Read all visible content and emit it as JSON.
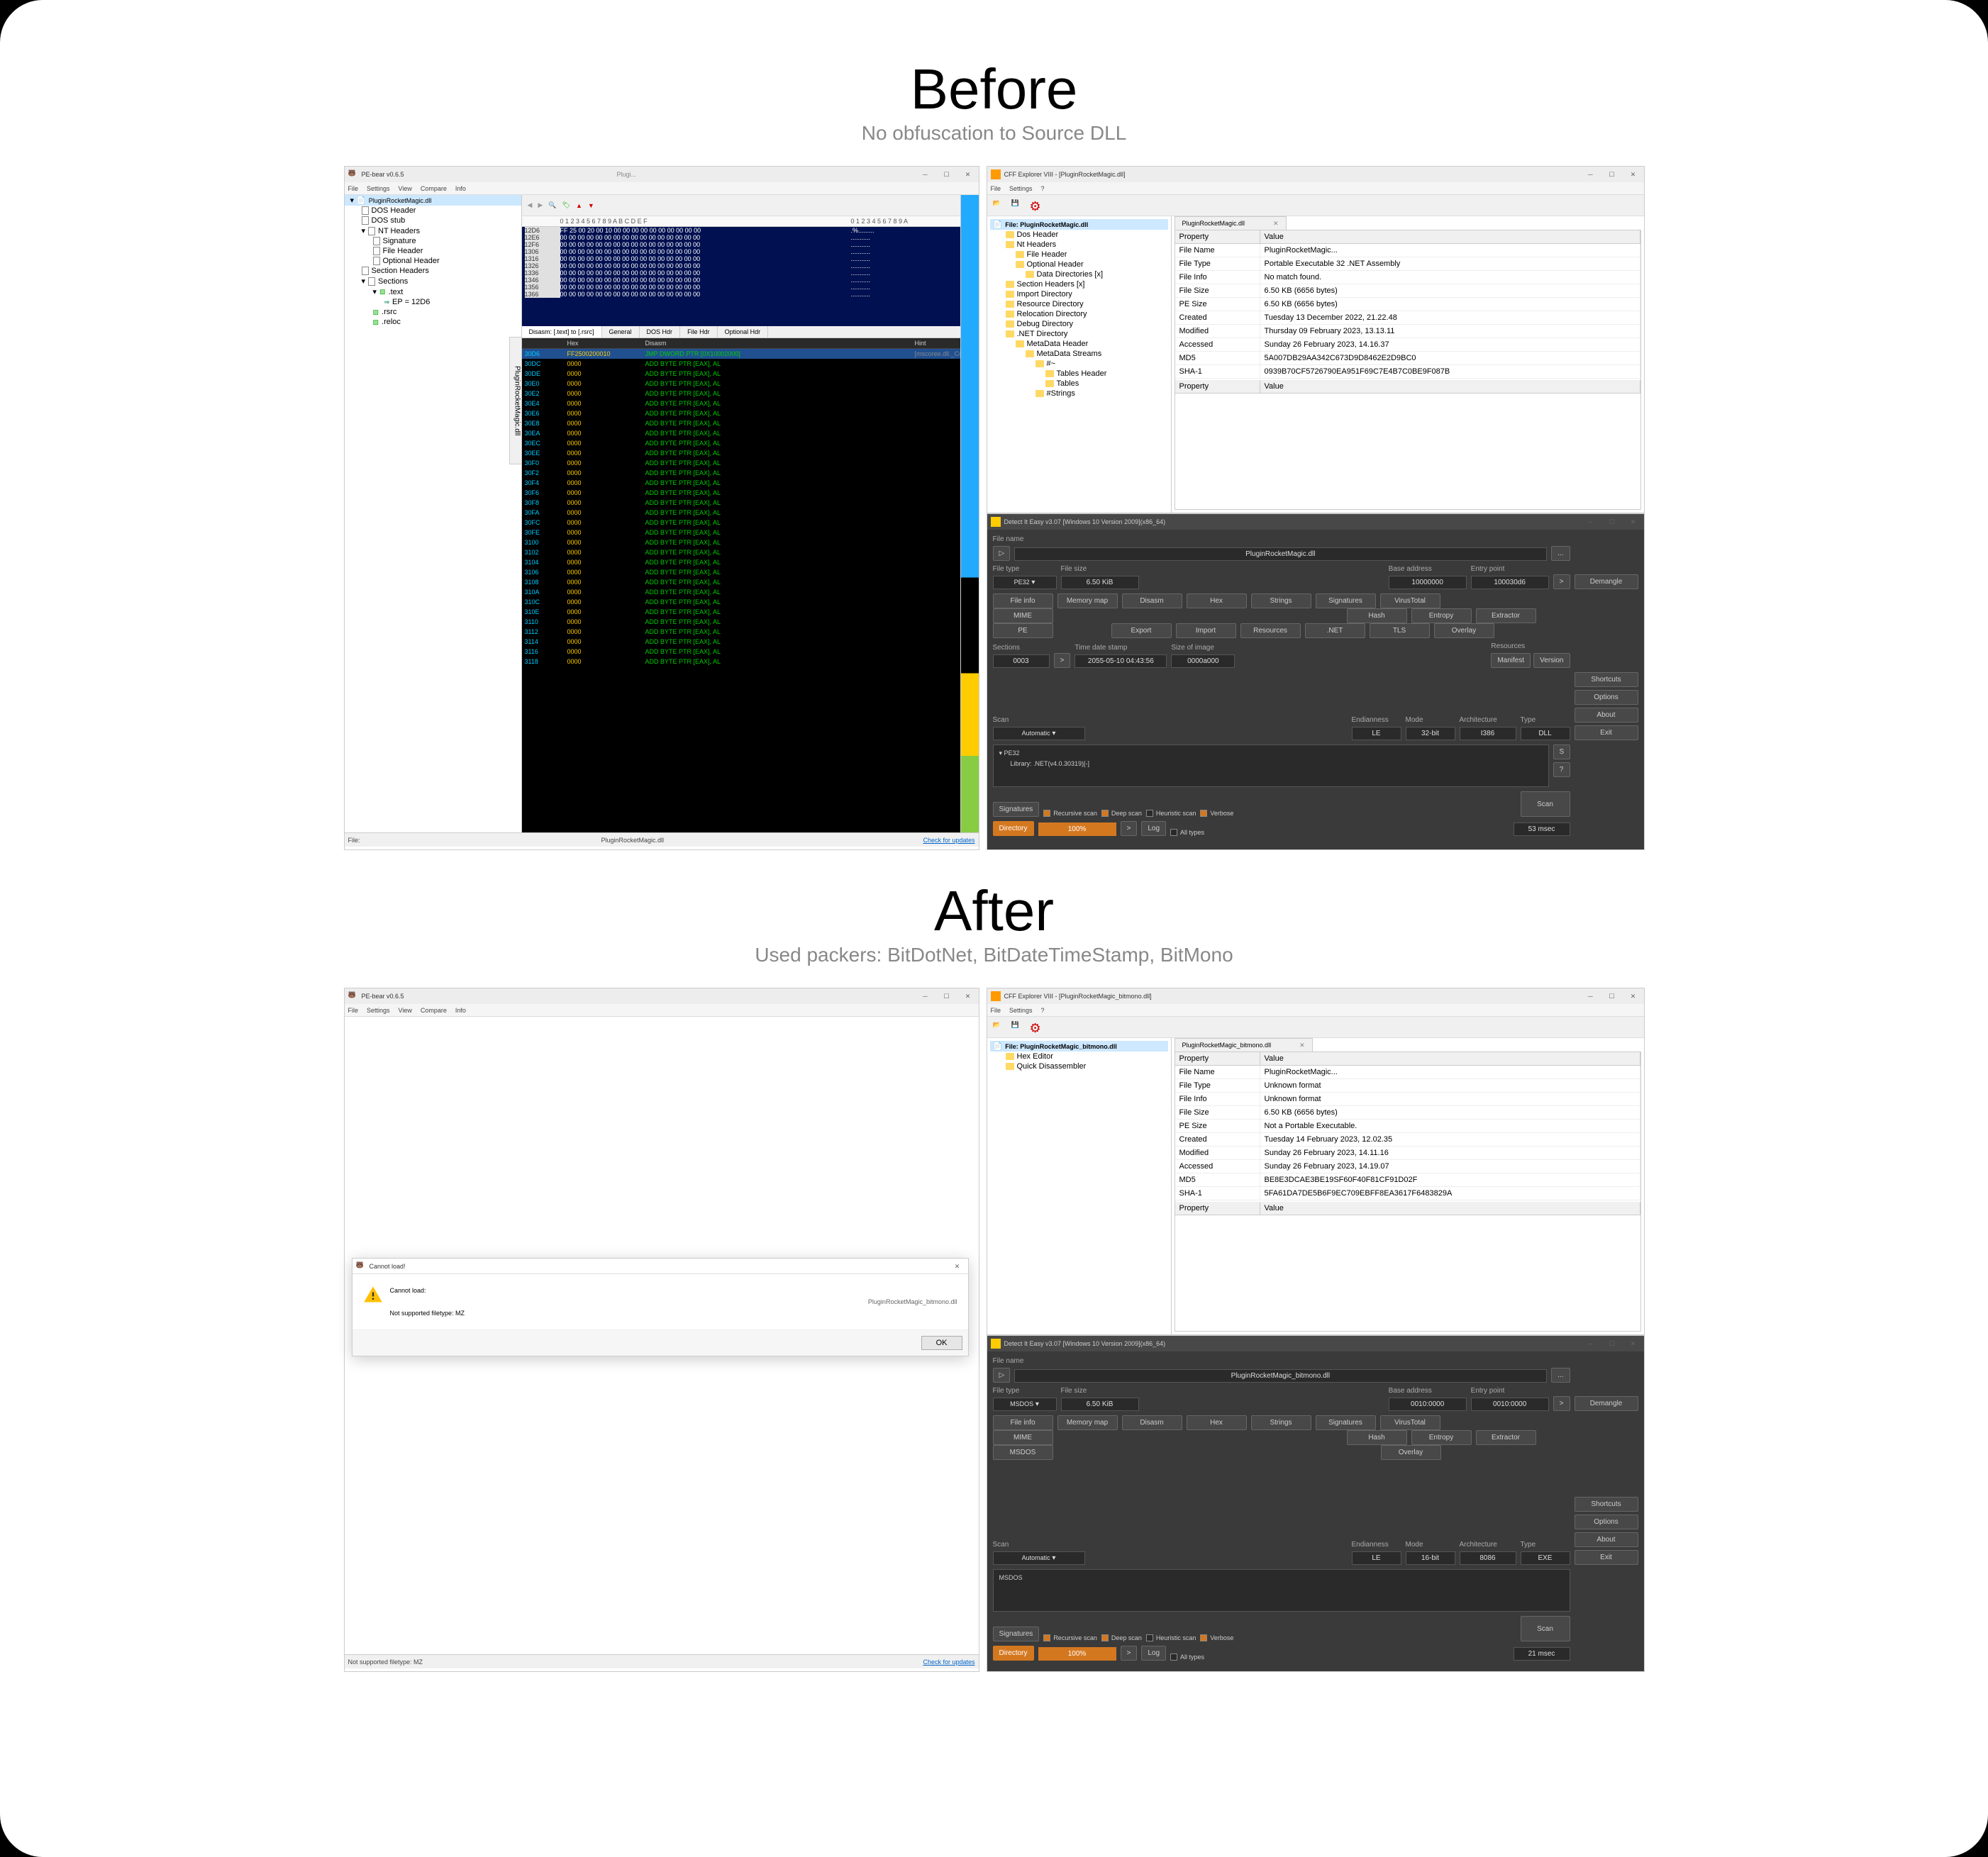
{
  "before": {
    "title": "Before",
    "subtitle": "No obfuscation to Source DLL"
  },
  "after": {
    "title": "After",
    "subtitle": "Used packers: BitDotNet, BitDateTimeStamp, BitMono"
  },
  "pbear_before": {
    "title": "PE-bear v0.6.5",
    "title_file": "Plugi...",
    "menu": [
      "File",
      "Settings",
      "View",
      "Compare",
      "Info"
    ],
    "tree_root": "PluginRocketMagic.dll",
    "tree": [
      {
        "label": "DOS Header",
        "lvl": 1
      },
      {
        "label": "DOS stub",
        "lvl": 1
      },
      {
        "label": "NT Headers",
        "lvl": 1,
        "exp": true
      },
      {
        "label": "Signature",
        "lvl": 2
      },
      {
        "label": "File Header",
        "lvl": 2
      },
      {
        "label": "Optional Header",
        "lvl": 2
      },
      {
        "label": "Section Headers",
        "lvl": 1
      },
      {
        "label": "Sections",
        "lvl": 1,
        "exp": true
      },
      {
        "label": ".text",
        "lvl": 2,
        "exp": true,
        "green": true
      },
      {
        "label": "EP = 12D6",
        "lvl": 3,
        "arrow": true
      },
      {
        "label": ".rsrc",
        "lvl": 2,
        "green": true
      },
      {
        "label": ".reloc",
        "lvl": 2,
        "green": true
      }
    ],
    "hex_header_ofs": "",
    "hex_header_hex": "0 1 2 3 4 5 6 7 8 9 A B C D E F",
    "hex_header_asc": "0 1 2 3 4 5 6 7 8 9 A",
    "hex_rows": [
      {
        "ofs": "12D6",
        "hx": "FF 25 00 20 00 10 00 00 00 00 00 00 00 00 00 00",
        "asc": ".%........."
      },
      {
        "ofs": "12E6",
        "hx": "00 00 00 00 00 00 00 00 00 00 00 00 00 00 00 00",
        "asc": "..........."
      },
      {
        "ofs": "12F6",
        "hx": "00 00 00 00 00 00 00 00 00 00 00 00 00 00 00 00",
        "asc": "..........."
      },
      {
        "ofs": "1306",
        "hx": "00 00 00 00 00 00 00 00 00 00 00 00 00 00 00 00",
        "asc": "..........."
      },
      {
        "ofs": "1316",
        "hx": "00 00 00 00 00 00 00 00 00 00 00 00 00 00 00 00",
        "asc": "..........."
      },
      {
        "ofs": "1326",
        "hx": "00 00 00 00 00 00 00 00 00 00 00 00 00 00 00 00",
        "asc": "..........."
      },
      {
        "ofs": "1336",
        "hx": "00 00 00 00 00 00 00 00 00 00 00 00 00 00 00 00",
        "asc": "..........."
      },
      {
        "ofs": "1346",
        "hx": "00 00 00 00 00 00 00 00 00 00 00 00 00 00 00 00",
        "asc": "..........."
      },
      {
        "ofs": "1356",
        "hx": "00 00 00 00 00 00 00 00 00 00 00 00 00 00 00 00",
        "asc": "..........."
      },
      {
        "ofs": "1366",
        "hx": "00 00 00 00 00 00 00 00 00 00 00 00 00 00 00 00",
        "asc": "..........."
      }
    ],
    "tabs": [
      "Disasm: [.text] to [.rsrc]",
      "General",
      "DOS Hdr",
      "File Hdr",
      "Optional Hdr"
    ],
    "disasm_head": {
      "c1": "",
      "c2": "Hex",
      "c3": "Disasm",
      "c4": "Hint"
    },
    "disasm_first": {
      "ofs": "30D6",
      "hex": "FF2500200010",
      "dis": "JMP DWORD PTR [0X10002000]",
      "hint": "[mscoree.dll._CorDll..."
    },
    "disasm_offsets": [
      "30DC",
      "30DE",
      "30E0",
      "30E2",
      "30E4",
      "30E6",
      "30E8",
      "30EA",
      "30EC",
      "30EE",
      "30F0",
      "30F2",
      "30F4",
      "30F6",
      "30F8",
      "30FA",
      "30FC",
      "30FE",
      "3100",
      "3102",
      "3104",
      "3106",
      "3108",
      "310A",
      "310C",
      "310E",
      "3110",
      "3112",
      "3114",
      "3116",
      "3118"
    ],
    "disasm_repeat_hex": "0000",
    "disasm_repeat_dis": "ADD BYTE PTR [EAX], AL",
    "status_left": "File:",
    "status_file": "PluginRocketMagic.dll",
    "status_link": "Check for updates",
    "vtab": "PluginRocketMagic.dll"
  },
  "cff_before": {
    "title": "CFF Explorer VIII - [PluginRocketMagic.dll]",
    "menu": [
      "File",
      "Settings",
      "?"
    ],
    "file_tab": "PluginRocketMagic.dll",
    "tree_root": "File: PluginRocketMagic.dll",
    "tree": [
      {
        "label": "Dos Header",
        "lvl": 1
      },
      {
        "label": "Nt Headers",
        "lvl": 1,
        "exp": true
      },
      {
        "label": "File Header",
        "lvl": 2
      },
      {
        "label": "Optional Header",
        "lvl": 2,
        "exp": true
      },
      {
        "label": "Data Directories [x]",
        "lvl": 3
      },
      {
        "label": "Section Headers [x]",
        "lvl": 1
      },
      {
        "label": "Import Directory",
        "lvl": 1
      },
      {
        "label": "Resource Directory",
        "lvl": 1
      },
      {
        "label": "Relocation Directory",
        "lvl": 1
      },
      {
        "label": "Debug Directory",
        "lvl": 1
      },
      {
        "label": ".NET Directory",
        "lvl": 1,
        "exp": true
      },
      {
        "label": "MetaData Header",
        "lvl": 2,
        "exp": true
      },
      {
        "label": "MetaData Streams",
        "lvl": 3,
        "exp": true
      },
      {
        "label": "#~",
        "lvl": 4,
        "exp": true
      },
      {
        "label": "Tables Header",
        "lvl": 5
      },
      {
        "label": "Tables",
        "lvl": 5
      },
      {
        "label": "#Strings",
        "lvl": 4
      }
    ],
    "table_header": [
      "Property",
      "Value"
    ],
    "rows": [
      [
        "File Name",
        "PluginRocketMagic..."
      ],
      [
        "File Type",
        "Portable Executable 32 .NET Assembly"
      ],
      [
        "File Info",
        "No match found."
      ],
      [
        "File Size",
        "6.50 KB (6656 bytes)"
      ],
      [
        "PE Size",
        "6.50 KB (6656 bytes)"
      ],
      [
        "Created",
        "Tuesday 13 December 2022, 21.22.48"
      ],
      [
        "Modified",
        "Thursday 09 February 2023, 13.13.11"
      ],
      [
        "Accessed",
        "Sunday 26 February 2023, 14.16.37"
      ],
      [
        "MD5",
        "5A007DB29AA342C673D9D8462E2D9BC0"
      ],
      [
        "SHA-1",
        "0939B70CF5726790EA951F69C7E4B7C0BE9F087B"
      ]
    ],
    "table_header2": [
      "Property",
      "Value"
    ]
  },
  "die_before": {
    "title": "Detect It Easy v3.07 [Windows 10 Version 2009](x86_64)",
    "file_name_label": "File name",
    "file_name": "PluginRocketMagic.dll",
    "file_type_label": "File type",
    "file_type": "PE32",
    "file_size_label": "File size",
    "file_size": "6.50 KiB",
    "base_addr_label": "Base address",
    "base_addr": "10000000",
    "entry_label": "Entry point",
    "entry": "100030d6",
    "demangle": "Demangle",
    "btns_row1": [
      "File info",
      "Memory map",
      "Disasm",
      "Hex",
      "Strings",
      "Signatures",
      "VirusTotal"
    ],
    "btns_row2": [
      "MIME",
      "",
      "",
      "",
      "Hash",
      "Entropy",
      "Extractor"
    ],
    "btns_row3": [
      "PE",
      "",
      "Export",
      "Import",
      "Resources",
      ".NET",
      "TLS",
      "Overlay"
    ],
    "sections_label": "Sections",
    "sections": "0003",
    "timedate_label": "Time date stamp",
    "timedate": "2055-05-10 04:43:56",
    "size_img_label": "Size of image",
    "size_img": "0000a000",
    "resources_label": "Resources",
    "manifest": "Manifest",
    "version": "Version",
    "scan_label": "Scan",
    "auto": "Automatic",
    "endian_label": "Endianness",
    "endian": "LE",
    "mode_label": "Mode",
    "mode": "32-bit",
    "arch_label": "Architecture",
    "arch": "I386",
    "type_label": "Type",
    "type": "DLL",
    "result_pe": "PE32",
    "result_lib": "Library: .NET(v4.0.30319)[-]",
    "s_btn": "S",
    "q_btn": "?",
    "signatures": "Signatures",
    "chk_recursive": "Recursive scan",
    "chk_deep": "Deep scan",
    "chk_heuristic": "Heuristic scan",
    "chk_verbose": "Verbose",
    "directory": "Directory",
    "progress": "100%",
    "log": "Log",
    "all_types": "All types",
    "elapsed": "53 msec",
    "scan": "Scan",
    "right_btns": [
      "Shortcuts",
      "Options",
      "About",
      "Exit"
    ],
    "arrow": ">",
    "ellipsis": "..."
  },
  "pbear_after": {
    "title": "PE-bear v0.6.5",
    "menu": [
      "File",
      "Settings",
      "View",
      "Compare",
      "Info"
    ],
    "msgbox_title": "Cannot load!",
    "msg_line1": "Cannot load:",
    "msg_file": "PluginRocketMagic_bitmono.dll",
    "msg_line2": "Not supported filetype: MZ",
    "ok": "OK",
    "status": "Not supported filetype: MZ",
    "status_link": "Check for updates"
  },
  "cff_after": {
    "title": "CFF Explorer VIII - [PluginRocketMagic_bitmono.dll]",
    "menu": [
      "File",
      "Settings",
      "?"
    ],
    "file_tab": "PluginRocketMagic_bitmono.dll",
    "tree_root": "File: PluginRocketMagic_bitmono.dll",
    "tree": [
      {
        "label": "Hex Editor",
        "lvl": 1
      },
      {
        "label": "Quick Disassembler",
        "lvl": 1
      }
    ],
    "table_header": [
      "Property",
      "Value"
    ],
    "rows": [
      [
        "File Name",
        "PluginRocketMagic..."
      ],
      [
        "File Type",
        "Unknown format"
      ],
      [
        "File Info",
        "Unknown format"
      ],
      [
        "File Size",
        "6.50 KB (6656 bytes)"
      ],
      [
        "PE Size",
        "Not a Portable Executable."
      ],
      [
        "Created",
        "Tuesday 14 February 2023, 12.02.35"
      ],
      [
        "Modified",
        "Sunday 26 February 2023, 14.11.16"
      ],
      [
        "Accessed",
        "Sunday 26 February 2023, 14.19.07"
      ],
      [
        "MD5",
        "BE8E3DCAE3BE19SF60F40F81CF91D02F"
      ],
      [
        "SHA-1",
        "5FA61DA7DE5B6F9EC709EBFF8EA3617F6483829A"
      ]
    ],
    "table_header2": [
      "Property",
      "Value"
    ]
  },
  "die_after": {
    "title": "Detect It Easy v3.07 [Windows 10 Version 2009](x86_64)",
    "file_name_label": "File name",
    "file_name": "PluginRocketMagic_bitmono.dll",
    "file_type_label": "File type",
    "file_type": "MSDOS",
    "file_size_label": "File size",
    "file_size": "6.50 KiB",
    "base_addr_label": "Base address",
    "base_addr": "0010:0000",
    "entry_label": "Entry point",
    "entry": "0010:0000",
    "demangle": "Demangle",
    "btns_row1": [
      "File info",
      "Memory map",
      "Disasm",
      "Hex",
      "Strings",
      "Signatures",
      "VirusTotal"
    ],
    "btns_row2": [
      "MIME",
      "",
      "",
      "",
      "Hash",
      "Entropy",
      "Extractor"
    ],
    "btns_row3": [
      "MSDOS",
      "",
      "",
      "",
      "",
      "",
      "",
      "Overlay"
    ],
    "scan_label": "Scan",
    "auto": "Automatic",
    "endian_label": "Endianness",
    "endian": "LE",
    "mode_label": "Mode",
    "mode": "16-bit",
    "arch_label": "Architecture",
    "arch": "8086",
    "type_label": "Type",
    "type": "EXE",
    "result_msdos": "MSDOS",
    "signatures": "Signatures",
    "chk_recursive": "Recursive scan",
    "chk_deep": "Deep scan",
    "chk_heuristic": "Heuristic scan",
    "chk_verbose": "Verbose",
    "directory": "Directory",
    "progress": "100%",
    "log": "Log",
    "all_types": "All types",
    "elapsed": "21 msec",
    "scan": "Scan",
    "right_btns": [
      "Shortcuts",
      "Options",
      "About",
      "Exit"
    ],
    "arrow": ">",
    "ellipsis": "..."
  }
}
